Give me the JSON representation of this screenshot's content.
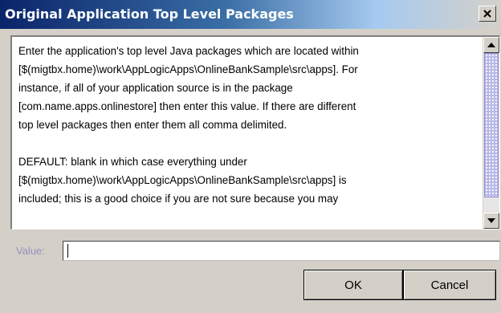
{
  "window": {
    "title": "Original Application Top Level Packages",
    "close_glyph": "✕"
  },
  "description": {
    "lines": [
      "Enter the application's top level Java packages which are located within",
      "[$(migtbx.home)\\work\\AppLogicApps\\OnlineBankSample\\src\\apps].  For",
      "instance, if all of your application source is in the package",
      "[com.name.apps.onlinestore] then enter this value. If there are different",
      "top level packages then enter them all comma delimited.",
      "",
      "DEFAULT: blank in which case everything under",
      "[$(migtbx.home)\\work\\AppLogicApps\\OnlineBankSample\\src\\apps] is",
      "included; this is a good choice if you are not sure because you may"
    ]
  },
  "scrollbar": {
    "up_icon": "scroll-up-arrow",
    "down_icon": "scroll-down-arrow"
  },
  "value_field": {
    "label": "Value:",
    "value": ""
  },
  "buttons": {
    "ok_label": "OK",
    "cancel_label": "Cancel"
  },
  "colors": {
    "title_start": "#0a246a",
    "title_end": "#a6caf0",
    "dialog_bg": "#d4d0c8",
    "thumb": "#b8b8e8",
    "label_color": "#9090c0"
  }
}
